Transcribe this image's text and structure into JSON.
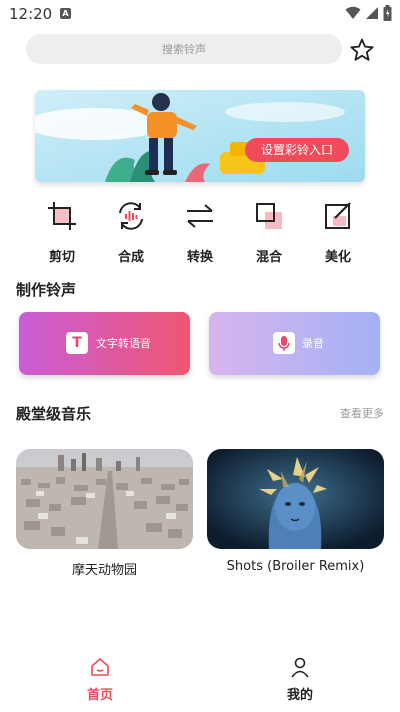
{
  "status": {
    "time": "12:20",
    "notification_badge": "A"
  },
  "search": {
    "placeholder": "搜索铃声"
  },
  "banner": {
    "button_label": "设置彩铃入口"
  },
  "tools": [
    {
      "label": "剪切",
      "icon": "crop-icon"
    },
    {
      "label": "合成",
      "icon": "merge-audio-icon"
    },
    {
      "label": "转换",
      "icon": "convert-icon"
    },
    {
      "label": "混合",
      "icon": "mix-icon"
    },
    {
      "label": "美化",
      "icon": "edit-icon"
    }
  ],
  "make_section": {
    "title": "制作铃声",
    "cards": [
      {
        "label": "文字转语音",
        "icon": "text-icon",
        "icon_glyph": "T"
      },
      {
        "label": "录音",
        "icon": "microphone-icon"
      }
    ]
  },
  "music_section": {
    "title": "殿堂级音乐",
    "more_label": "查看更多",
    "items": [
      {
        "title": "摩天动物园"
      },
      {
        "title": "Shots (Broiler Remix)"
      }
    ]
  },
  "nav": {
    "items": [
      {
        "label": "首页",
        "active": true
      },
      {
        "label": "我的",
        "active": false
      }
    ]
  },
  "colors": {
    "accent": "#ef4b5b",
    "text": "#222222",
    "muted": "#999999"
  }
}
